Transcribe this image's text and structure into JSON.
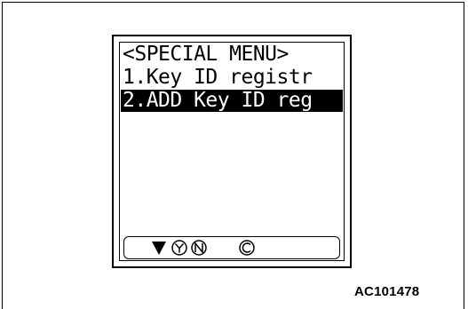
{
  "menu": {
    "title": "<SPECIAL MENU>",
    "items": [
      {
        "label": "1.Key ID registr",
        "selected": false
      },
      {
        "label": "2.ADD Key ID reg",
        "selected": true
      }
    ]
  },
  "softkeys": [
    {
      "icon": "down-arrow-icon"
    },
    {
      "icon": "y-key-icon"
    },
    {
      "icon": "n-key-icon"
    },
    {
      "icon": "c-key-icon"
    }
  ],
  "figure": {
    "code": "AC101478"
  }
}
